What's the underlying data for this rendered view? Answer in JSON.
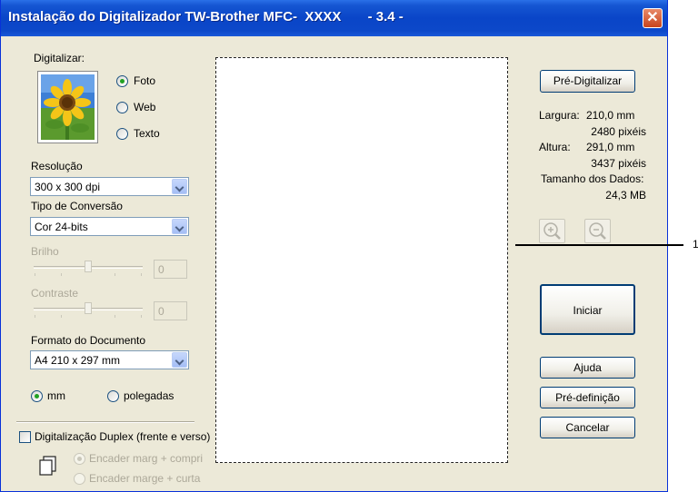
{
  "window": {
    "title": "Instalação do Digitalizador TW-Brother MFC-  XXXX       - 3.4 -",
    "close_glyph": "✕"
  },
  "left": {
    "scan_label": "Digitalizar:",
    "scan_types": [
      {
        "label": "Foto",
        "selected": true
      },
      {
        "label": "Web",
        "selected": false
      },
      {
        "label": "Texto",
        "selected": false
      }
    ],
    "resolution_label": "Resolução",
    "resolution_value": "300 x 300 dpi",
    "conversion_label": "Tipo de Conversão",
    "conversion_value": "Cor 24-bits",
    "brightness_label": "Brilho",
    "brightness_value": "0",
    "contrast_label": "Contraste",
    "contrast_value": "0",
    "doc_size_label": "Formato do Documento",
    "doc_size_value": "A4 210 x 297 mm",
    "units": [
      {
        "label": "mm",
        "selected": true
      },
      {
        "label": "polegadas",
        "selected": false
      }
    ],
    "duplex_label": "Digitalização Duplex (frente e verso)",
    "duplex_options": [
      {
        "label": "Encader marg + compri",
        "selected": true
      },
      {
        "label": "Encader marge + curta",
        "selected": false
      }
    ]
  },
  "right": {
    "prescan_label": "Pré-Digitalizar",
    "width_label": "Largura:",
    "width_mm": "210,0 mm",
    "width_px": "2480 pixéis",
    "height_label": "Altura:",
    "height_mm": "291,0 mm",
    "height_px": "3437 pixéis",
    "data_size_label": "Tamanho dos Dados:",
    "data_size_value": "24,3 MB",
    "start_label": "Iniciar",
    "help_label": "Ajuda",
    "default_label": "Pré-definição",
    "cancel_label": "Cancelar"
  },
  "callout": {
    "number": "1"
  },
  "colors": {
    "titlebar": "#0a45c8",
    "dialog_bg": "#ece9d8",
    "button_border": "#003c74",
    "radio_dot": "#21a121"
  },
  "icons": [
    "close-icon",
    "zoom-in-icon",
    "zoom-out-icon",
    "duplex-pages-icon",
    "sunflower-photo-icon"
  ]
}
